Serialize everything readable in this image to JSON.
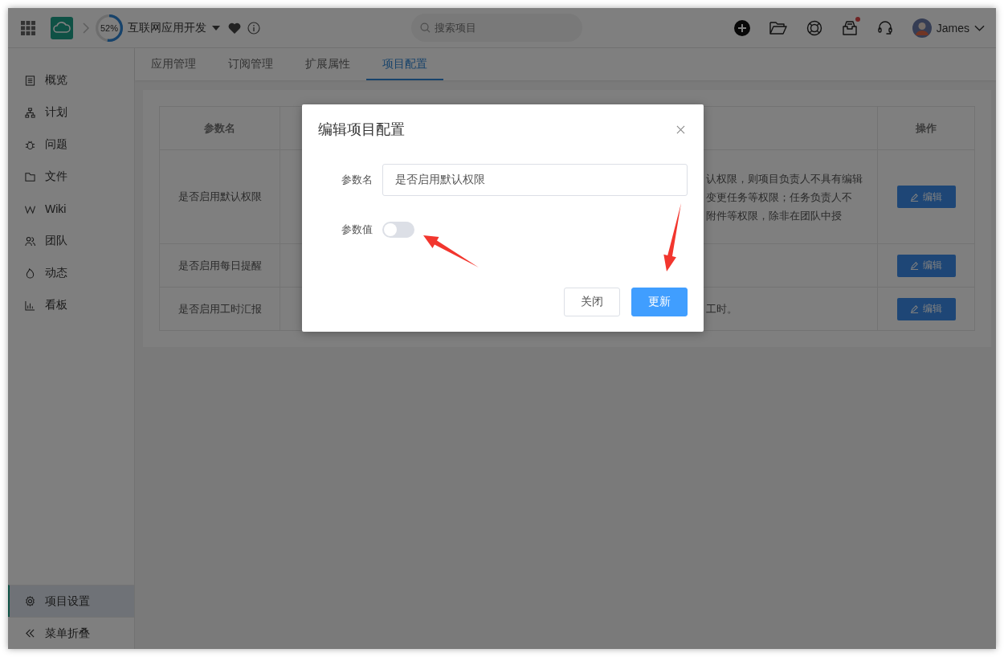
{
  "header": {
    "progress": {
      "level": 0.52,
      "label": "52%"
    },
    "project": "互联网应用开发",
    "search": {
      "placeholder": "搜索项目"
    },
    "inbox_unread": true,
    "user": "James"
  },
  "sidebar": {
    "items": [
      {
        "label": "概览",
        "selected": false
      },
      {
        "label": "计划",
        "selected": false
      },
      {
        "label": "问题",
        "selected": false
      },
      {
        "label": "文件",
        "selected": false
      },
      {
        "label": "Wiki",
        "selected": false
      },
      {
        "label": "团队",
        "selected": false
      },
      {
        "label": "动态",
        "selected": false
      },
      {
        "label": "看板",
        "selected": false
      }
    ],
    "settings": {
      "label": "项目设置",
      "selected": true
    },
    "collapse": "菜单折叠"
  },
  "tabs": [
    {
      "label": "应用管理",
      "selected": false
    },
    {
      "label": "订阅管理",
      "selected": false
    },
    {
      "label": "扩展属性",
      "selected": false
    },
    {
      "label": "项目配置",
      "selected": true
    }
  ],
  "table": {
    "columns": [
      "参数名",
      "操作"
    ],
    "rows": [
      {
        "name": "是否启用默认权限",
        "description": [
          "认权限，则项目负责人不具有编辑",
          "变更任务等权限；任务负责人不",
          "附件等权限，除非在团队中授"
        ],
        "action": "编辑"
      },
      {
        "name": "是否启用每日提醒",
        "action": "编辑"
      },
      {
        "name": "是否启用工时汇报",
        "description": [
          "工时。"
        ],
        "action": "编辑"
      }
    ]
  },
  "dialog": {
    "title": "编辑项目配置",
    "fields": [
      {
        "kind": "text",
        "label": "参数名",
        "value": "是否启用默认权限"
      },
      {
        "kind": "switch",
        "label": "参数值",
        "on": false
      }
    ],
    "buttons": [
      {
        "label": "关闭",
        "primary": false
      },
      {
        "label": "更新",
        "primary": true
      }
    ]
  }
}
